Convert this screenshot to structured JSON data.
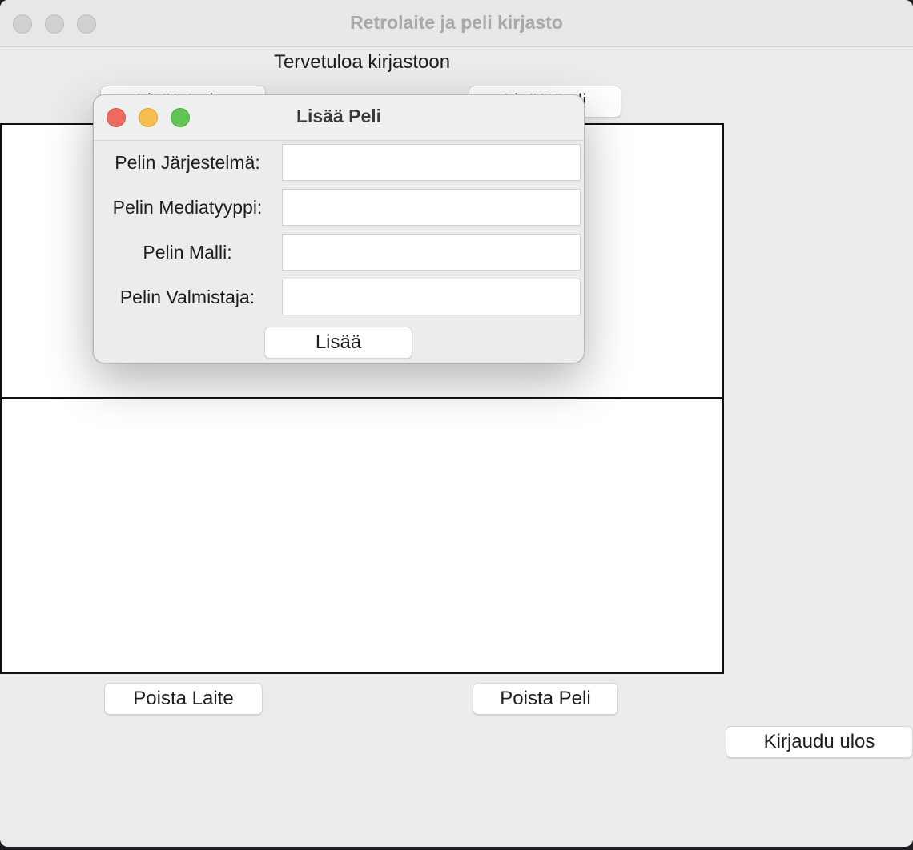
{
  "main_window": {
    "title": "Retrolaite ja peli kirjasto",
    "welcome": "Tervetuloa kirjastoon",
    "add_device_label": "Lisää Laite",
    "add_game_label": "Lisää Peli",
    "remove_device_label": "Poista Laite",
    "remove_game_label": "Poista Peli",
    "logout_label": "Kirjaudu ulos"
  },
  "dialog": {
    "title": "Lisää Peli",
    "fields": [
      {
        "label": "Pelin Järjestelmä:",
        "value": ""
      },
      {
        "label": "Pelin Mediatyyppi:",
        "value": ""
      },
      {
        "label": "Pelin Malli:",
        "value": ""
      },
      {
        "label": "Pelin Valmistaja:",
        "value": ""
      }
    ],
    "submit_label": "Lisää"
  },
  "colors": {
    "window_bg": "#ececec",
    "close": "#ed6a5e",
    "minimize": "#f5bf4f",
    "zoom": "#61c554",
    "list_border": "#111111"
  }
}
